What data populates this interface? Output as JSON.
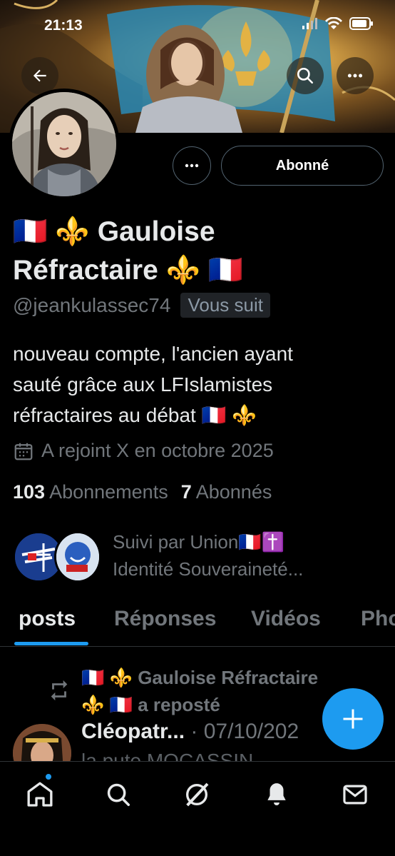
{
  "status_bar": {
    "time": "21:13"
  },
  "profile": {
    "name_line1": "🇫🇷 ⚜️ Gauloise",
    "name_line2": "Réfractaire ⚜️ 🇫🇷",
    "handle": "@jeankulassec74",
    "follows_you": "Vous suit",
    "follow_button": "Abonné",
    "bio_line1": "nouveau compte, l'ancien ayant",
    "bio_line2": "sauté grâce aux LFIslamistes",
    "bio_line3": "réfractaires au débat 🇫🇷 ⚜️",
    "joined": "A rejoint X en octobre 2025",
    "following_count": "103",
    "following_label": "Abonnements",
    "followers_count": "7",
    "followers_label": "Abonnés",
    "followed_by_line1": "Suivi par Union🇫🇷✝️",
    "followed_by_line2": "Identité Souveraineté..."
  },
  "tabs": [
    {
      "label": "posts"
    },
    {
      "label": "Réponses"
    },
    {
      "label": "Vidéos"
    },
    {
      "label": "Pho"
    }
  ],
  "feed": {
    "repost_line1": "🇫🇷 ⚜️ Gauloise Réfractaire",
    "repost_line2": "⚜️ 🇫🇷 a reposté",
    "post_author": "Cléopatr...",
    "post_date": "· 07/10/202",
    "post_text_partial": "la pute MOCASSIN"
  },
  "colors": {
    "accent": "#1d9bf0",
    "background": "#000000",
    "muted": "#71767b"
  },
  "icons": {
    "back": "arrow-left-icon",
    "search": "search-icon",
    "more": "more-icon",
    "calendar": "calendar-icon",
    "repost": "repost-icon",
    "compose": "plus-icon",
    "nav": [
      "home-icon",
      "search-icon",
      "grok-icon",
      "notifications-icon",
      "messages-icon"
    ]
  }
}
